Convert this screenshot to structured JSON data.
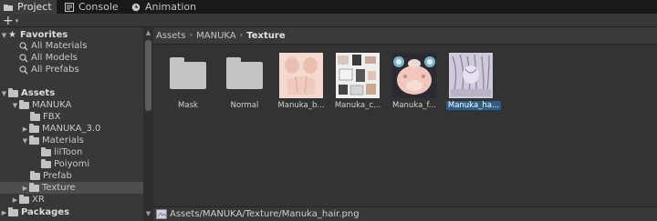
{
  "tabs": [
    {
      "label": "Project",
      "icon": "folder-icon"
    },
    {
      "label": "Console",
      "icon": "console-icon"
    },
    {
      "label": "Animation",
      "icon": "animation-clock-icon"
    }
  ],
  "toolbar": {
    "add_label": "+",
    "add_caret": "▾"
  },
  "tree": {
    "favorites": {
      "label": "Favorites",
      "items": [
        "All Materials",
        "All Models",
        "All Prefabs"
      ]
    },
    "assets": {
      "label": "Assets"
    },
    "manuka": "MANUKA",
    "fbx": "FBX",
    "manuka30": "MANUKA_3.0",
    "materials": "Materials",
    "liltoon": "lilToon",
    "poiyomi": "Poiyomi",
    "prefab": "Prefab",
    "texture": "Texture",
    "xr": "XR",
    "packages": "Packages"
  },
  "breadcrumb": {
    "parts": [
      "Assets",
      "MANUKA"
    ],
    "current": "Texture",
    "separator": "›"
  },
  "assets": [
    {
      "label": "Mask",
      "kind": "folder"
    },
    {
      "label": "Normal",
      "kind": "folder"
    },
    {
      "label": "Manuka_b...",
      "kind": "texture"
    },
    {
      "label": "Manuka_c...",
      "kind": "texture"
    },
    {
      "label": "Manuka_f...",
      "kind": "texture"
    },
    {
      "label": "Manuka_ha...",
      "kind": "texture",
      "selected": true
    }
  ],
  "status": {
    "path": "Assets/MANUKA/Texture/Manuka_hair.png"
  },
  "colors": {
    "selection": "#2c5d87",
    "panel": "#383838",
    "content": "#333333"
  }
}
